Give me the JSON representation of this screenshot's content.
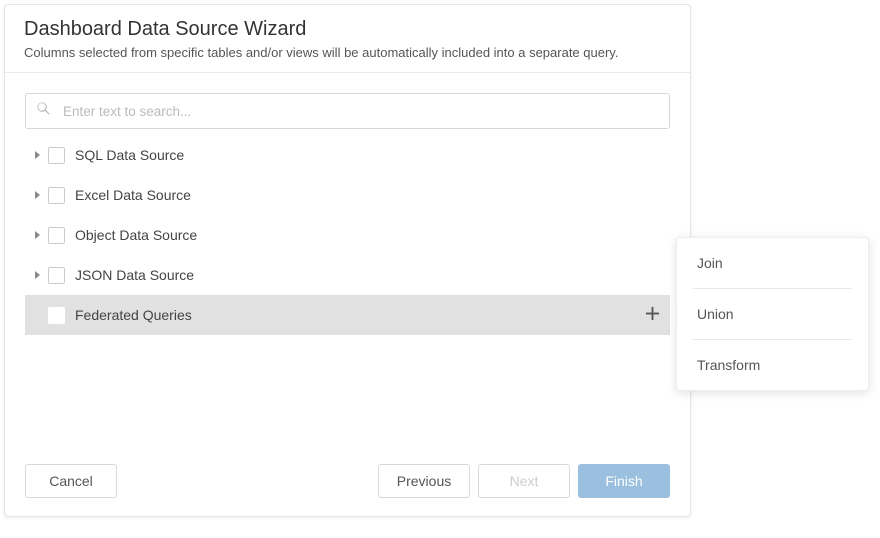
{
  "header": {
    "title": "Dashboard Data Source Wizard",
    "subtitle": "Columns selected from specific tables and/or views will be automatically included into a separate query."
  },
  "search": {
    "placeholder": "Enter text to search..."
  },
  "tree": {
    "items": [
      {
        "label": "SQL Data Source"
      },
      {
        "label": "Excel Data Source"
      },
      {
        "label": "Object Data Source"
      },
      {
        "label": "JSON Data Source"
      },
      {
        "label": "Federated Queries"
      }
    ]
  },
  "footer": {
    "cancel": "Cancel",
    "previous": "Previous",
    "next": "Next",
    "finish": "Finish"
  },
  "popup": {
    "items": [
      {
        "label": "Join"
      },
      {
        "label": "Union"
      },
      {
        "label": "Transform"
      }
    ]
  }
}
